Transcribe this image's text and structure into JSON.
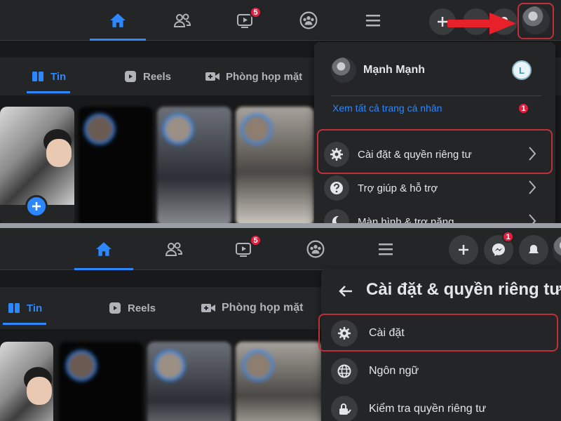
{
  "top": {
    "nav": {
      "video_badge": "5"
    },
    "feed_tabs": [
      {
        "label": "Tin"
      },
      {
        "label": "Reels"
      },
      {
        "label": "Phòng họp mặt"
      }
    ],
    "menu": {
      "profile_name": "Mạnh Mạnh",
      "profile_letter": "L",
      "see_all": "Xem tất cả trang cá nhân",
      "see_all_badge": "1",
      "items": [
        {
          "label": "Cài đặt & quyền riêng tư",
          "icon": "gear-icon"
        },
        {
          "label": "Trợ giúp & hỗ trợ",
          "icon": "help-icon"
        },
        {
          "label": "Màn hình & trợ năng",
          "icon": "moon-icon"
        }
      ]
    }
  },
  "bottom": {
    "nav": {
      "video_badge": "5",
      "messenger_badge": "1"
    },
    "feed_tabs": [
      {
        "label": "Tin"
      },
      {
        "label": "Reels"
      },
      {
        "label": "Phòng họp mặt"
      }
    ],
    "menu": {
      "title": "Cài đặt & quyền riêng tư",
      "items": [
        {
          "label": "Cài đặt",
          "icon": "gear-icon"
        },
        {
          "label": "Ngôn ngữ",
          "icon": "globe-icon"
        },
        {
          "label": "Kiểm tra quyền riêng tư",
          "icon": "lock-icon"
        }
      ]
    }
  },
  "colors": {
    "accent": "#2d88ff",
    "highlight": "#c0303a",
    "arrow": "#e8202a",
    "badge": "#e41e3f"
  }
}
